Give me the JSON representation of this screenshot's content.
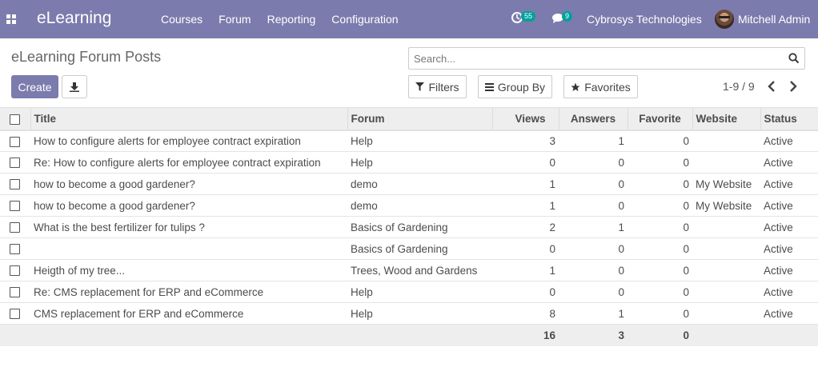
{
  "navbar": {
    "brand": "eLearning",
    "menu": [
      "Courses",
      "Forum",
      "Reporting",
      "Configuration"
    ],
    "activity_count": "55",
    "messages_count": "9",
    "company": "Cybrosys Technologies",
    "user": "Mitchell Admin",
    "color": "#7c7bad"
  },
  "control": {
    "title": "eLearning Forum Posts",
    "search_placeholder": "Search...",
    "create_label": "Create",
    "filters_label": "Filters",
    "group_by_label": "Group By",
    "favorites_label": "Favorites",
    "pager": "1-9 / 9"
  },
  "table": {
    "columns": [
      "Title",
      "Forum",
      "Views",
      "Answers",
      "Favorite",
      "Website",
      "Status"
    ],
    "rows": [
      {
        "title": "How to configure alerts for employee contract expiration",
        "forum": "Help",
        "views": "3",
        "answers": "1",
        "favorite": "0",
        "website": "",
        "status": "Active"
      },
      {
        "title": "Re: How to configure alerts for employee contract expiration",
        "forum": "Help",
        "views": "0",
        "answers": "0",
        "favorite": "0",
        "website": "",
        "status": "Active"
      },
      {
        "title": "how to become a good gardener?",
        "forum": "demo",
        "views": "1",
        "answers": "0",
        "favorite": "0",
        "website": "My Website",
        "status": "Active"
      },
      {
        "title": "how to become a good gardener?",
        "forum": "demo",
        "views": "1",
        "answers": "0",
        "favorite": "0",
        "website": "My Website",
        "status": "Active"
      },
      {
        "title": "What is the best fertilizer for tulips ?",
        "forum": "Basics of Gardening",
        "views": "2",
        "answers": "1",
        "favorite": "0",
        "website": "",
        "status": "Active"
      },
      {
        "title": "",
        "forum": "Basics of Gardening",
        "views": "0",
        "answers": "0",
        "favorite": "0",
        "website": "",
        "status": "Active"
      },
      {
        "title": "Heigth of my tree...",
        "forum": "Trees, Wood and Gardens",
        "views": "1",
        "answers": "0",
        "favorite": "0",
        "website": "",
        "status": "Active"
      },
      {
        "title": "Re: CMS replacement for ERP and eCommerce",
        "forum": "Help",
        "views": "0",
        "answers": "0",
        "favorite": "0",
        "website": "",
        "status": "Active"
      },
      {
        "title": "CMS replacement for ERP and eCommerce",
        "forum": "Help",
        "views": "8",
        "answers": "1",
        "favorite": "0",
        "website": "",
        "status": "Active"
      }
    ],
    "totals": {
      "views": "16",
      "answers": "3",
      "favorite": "0"
    }
  }
}
